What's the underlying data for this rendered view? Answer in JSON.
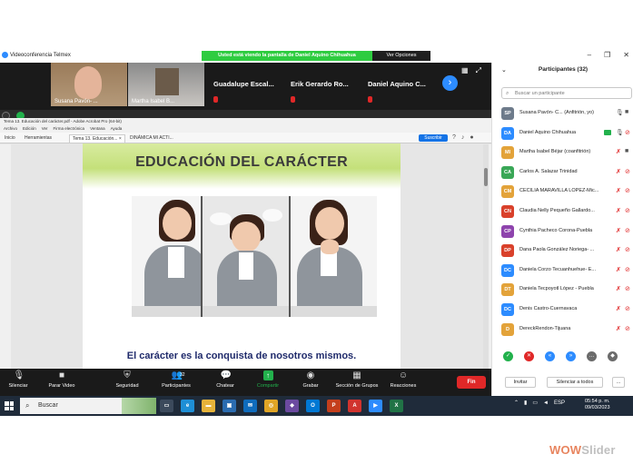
{
  "app": {
    "title": "Videoconferencia Telmex"
  },
  "share_banner": "Usted está viendo la pantalla de Daniel Aquino Chihuahua",
  "view_options": "Ver Opciones",
  "gallery": {
    "tiles": [
      {
        "name": "Susana Pavón- ...",
        "kind": "video"
      },
      {
        "name": "Martha Isabel B...",
        "kind": "video"
      },
      {
        "name": "Guadalupe Escal...",
        "kind": "text"
      },
      {
        "name": "Erik Gerardo Ro...",
        "kind": "text"
      },
      {
        "name": "Daniel Aquino C...",
        "kind": "text"
      }
    ]
  },
  "acrobat": {
    "window_title": "Tema 13. Educación del carácter.pdf - Adobe Acrobat Pro (64-bit)",
    "menu": [
      "Archivo",
      "Edición",
      "Ver",
      "Firma electrónica",
      "Ventana",
      "Ayuda"
    ],
    "tabs": [
      "Inicio",
      "Herramientas",
      "Tema 13. Educación... ×",
      "DINÁMICA MI ACTI..."
    ],
    "subscribe": "Suscribir"
  },
  "slide": {
    "title": "EDUCACIÓN DEL CARÁCTER",
    "subtitle": "El carácter es la conquista de nosotros mismos."
  },
  "toolbar": {
    "buttons": [
      {
        "label": "Silenciar",
        "icon": "microphone-icon"
      },
      {
        "label": "Parar Video",
        "icon": "video-camera-icon"
      },
      {
        "label": "Seguridad",
        "icon": "shield-icon"
      },
      {
        "label": "Participantes",
        "icon": "participants-icon",
        "count": "32"
      },
      {
        "label": "Chatear",
        "icon": "chat-icon"
      },
      {
        "label": "Compartir",
        "icon": "share-screen-icon"
      },
      {
        "label": "Grabar",
        "icon": "record-icon"
      },
      {
        "label": "Sección de Grupos",
        "icon": "breakout-rooms-icon"
      },
      {
        "label": "Reacciones",
        "icon": "reactions-icon"
      }
    ],
    "end": "Fin"
  },
  "participants": {
    "title": "Participantes (32)",
    "search_placeholder": "Buscar un participante",
    "list": [
      {
        "initials": "SP",
        "name": "Susana Pavón- C... (Anfitrión, yo)",
        "color": "#6e7b8b",
        "mic": "on",
        "cam": "on"
      },
      {
        "initials": "DA",
        "name": "Daniel Aquino Chihuahua",
        "color": "#2d8cff",
        "mic": "on",
        "cam": "off",
        "sharing": true
      },
      {
        "initials": "MI",
        "name": "Martha Isabel Béjar (coanfitrión)",
        "color": "#e3a33a",
        "mic": "off",
        "cam": "on"
      },
      {
        "initials": "CA",
        "name": "Carlos A. Salazar Trinidad",
        "color": "#3aa757",
        "mic": "off",
        "cam": "off"
      },
      {
        "initials": "CM",
        "name": "CECILIA MARAVILLA LOPEZ-Mic...",
        "color": "#e3a33a",
        "mic": "off",
        "cam": "off"
      },
      {
        "initials": "CN",
        "name": "Claudia Nelly Pequeño Gallardo...",
        "color": "#d9412b",
        "mic": "off",
        "cam": "off"
      },
      {
        "initials": "CP",
        "name": "Cynthia Pacheco Corona-Puebla",
        "color": "#8e44ad",
        "mic": "off",
        "cam": "off"
      },
      {
        "initials": "DP",
        "name": "Dana Paola González Noriega- ...",
        "color": "#d9412b",
        "mic": "off",
        "cam": "off"
      },
      {
        "initials": "DC",
        "name": "Daniela Corzo Tecuanhuehue- E...",
        "color": "#2d8cff",
        "mic": "off",
        "cam": "off"
      },
      {
        "initials": "DT",
        "name": "Daniela Tecpoyotl López - Puebla",
        "color": "#e3a33a",
        "mic": "off",
        "cam": "off"
      },
      {
        "initials": "DC",
        "name": "Denis Castro-Cuernavaca",
        "color": "#2d8cff",
        "mic": "off",
        "cam": "off"
      },
      {
        "initials": "D",
        "name": "DereckRendon-Tijuana",
        "color": "#e3a33a",
        "mic": "off",
        "cam": "off"
      }
    ],
    "reactions": [
      {
        "icon": "check-icon",
        "glyph": "✓",
        "color": "#22b14c"
      },
      {
        "icon": "x-icon",
        "glyph": "✕",
        "color": "#e02828"
      },
      {
        "icon": "rewind-icon",
        "glyph": "«",
        "color": "#2d8cff"
      },
      {
        "icon": "fast-forward-icon",
        "glyph": "»",
        "color": "#2d8cff"
      },
      {
        "icon": "more-icon",
        "glyph": "…",
        "color": "#6b6b6b"
      },
      {
        "icon": "coffee-icon",
        "glyph": "◆",
        "color": "#6b6b6b"
      }
    ],
    "invite": "Invitar",
    "mute_all": "Silenciar a todos",
    "more": "..."
  },
  "taskbar": {
    "search": "Buscar",
    "lang": "ESP",
    "time": "05:54 p. m.",
    "date": "09/03/2023"
  },
  "watermark": {
    "part1": "WOW",
    "part2": "Slider"
  }
}
